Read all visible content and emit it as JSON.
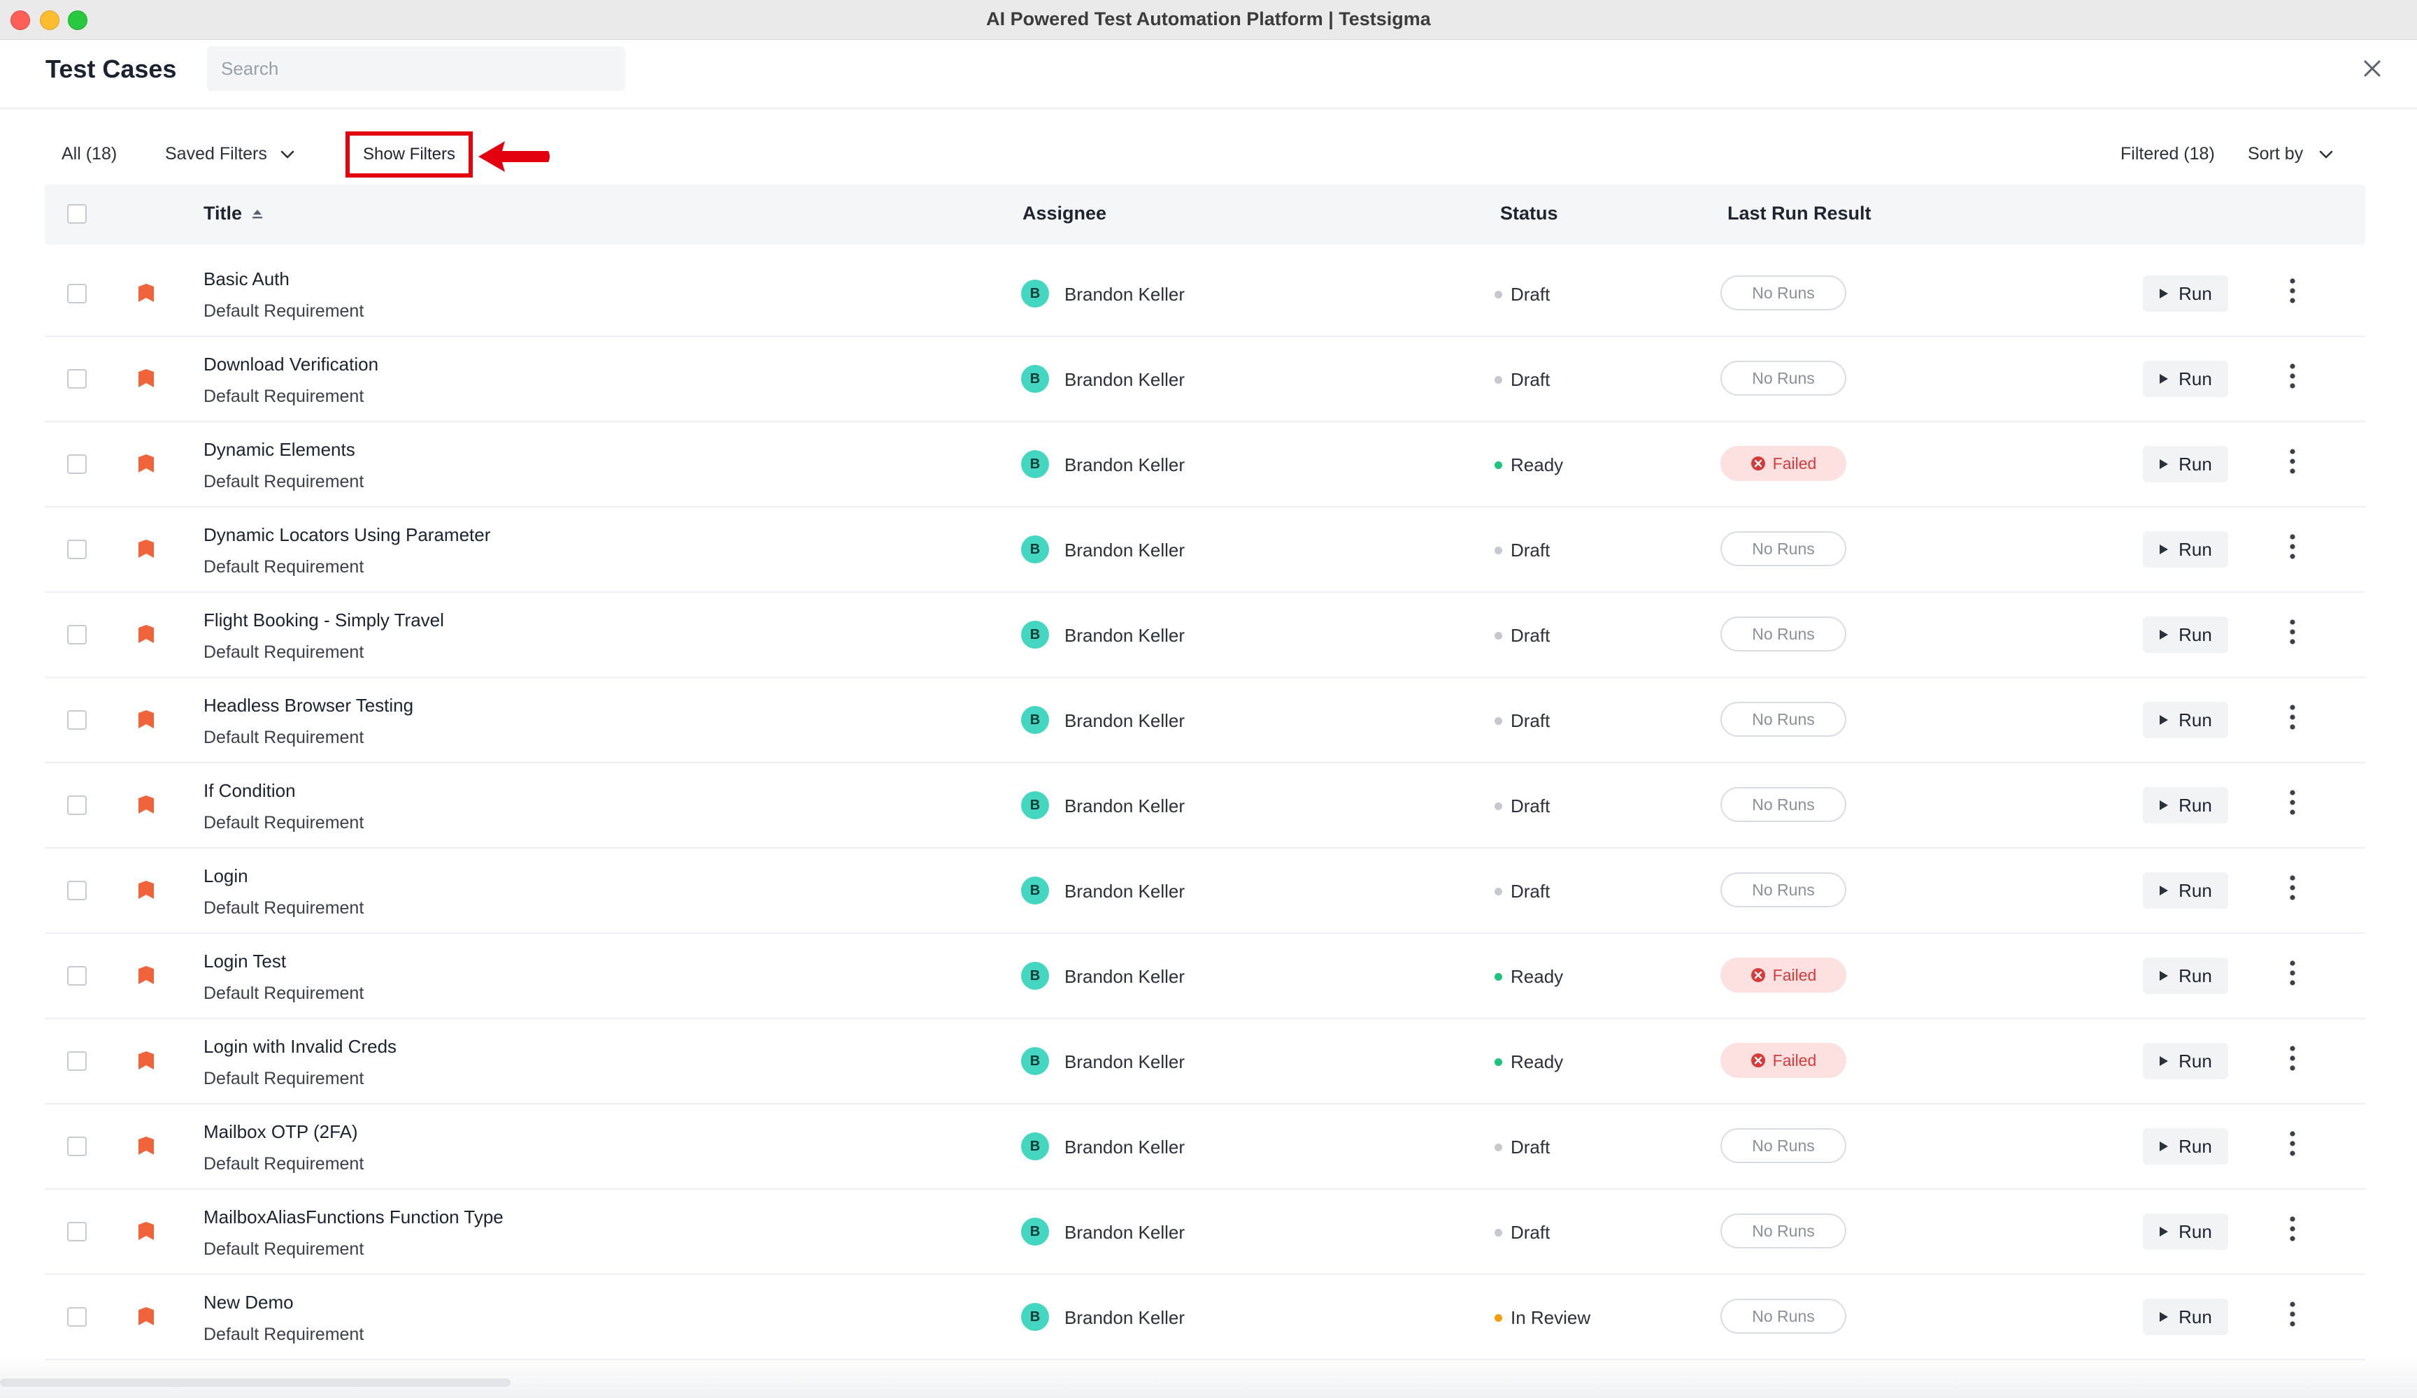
{
  "window": {
    "title": "AI Powered Test Automation Platform | Testsigma"
  },
  "header": {
    "title": "Test Cases",
    "search_placeholder": "Search",
    "close_icon": "close-icon"
  },
  "toolbar": {
    "all_label": "All (18)",
    "saved_filters_label": "Saved Filters",
    "show_filters_label": "Show Filters",
    "filtered_label": "Filtered (18)",
    "sort_by_label": "Sort by"
  },
  "table": {
    "columns": {
      "title": "Title",
      "assignee": "Assignee",
      "status": "Status",
      "last_run": "Last Run Result"
    },
    "run_label": "Run",
    "rows": [
      {
        "title": "Basic Auth",
        "requirement": "Default Requirement",
        "avatar": "B",
        "assignee": "Brandon Keller",
        "status": "Draft",
        "result": "No Runs"
      },
      {
        "title": "Download Verification",
        "requirement": "Default Requirement",
        "avatar": "B",
        "assignee": "Brandon Keller",
        "status": "Draft",
        "result": "No Runs"
      },
      {
        "title": "Dynamic Elements",
        "requirement": "Default Requirement",
        "avatar": "B",
        "assignee": "Brandon Keller",
        "status": "Ready",
        "result": "Failed"
      },
      {
        "title": "Dynamic Locators Using Parameter",
        "requirement": "Default Requirement",
        "avatar": "B",
        "assignee": "Brandon Keller",
        "status": "Draft",
        "result": "No Runs"
      },
      {
        "title": "Flight Booking - Simply Travel",
        "requirement": "Default Requirement",
        "avatar": "B",
        "assignee": "Brandon Keller",
        "status": "Draft",
        "result": "No Runs"
      },
      {
        "title": "Headless Browser Testing",
        "requirement": "Default Requirement",
        "avatar": "B",
        "assignee": "Brandon Keller",
        "status": "Draft",
        "result": "No Runs"
      },
      {
        "title": "If Condition",
        "requirement": "Default Requirement",
        "avatar": "B",
        "assignee": "Brandon Keller",
        "status": "Draft",
        "result": "No Runs"
      },
      {
        "title": "Login",
        "requirement": "Default Requirement",
        "avatar": "B",
        "assignee": "Brandon Keller",
        "status": "Draft",
        "result": "No Runs"
      },
      {
        "title": "Login Test",
        "requirement": "Default Requirement",
        "avatar": "B",
        "assignee": "Brandon Keller",
        "status": "Ready",
        "result": "Failed"
      },
      {
        "title": "Login with Invalid Creds",
        "requirement": "Default Requirement",
        "avatar": "B",
        "assignee": "Brandon Keller",
        "status": "Ready",
        "result": "Failed"
      },
      {
        "title": "Mailbox OTP (2FA)",
        "requirement": "Default Requirement",
        "avatar": "B",
        "assignee": "Brandon Keller",
        "status": "Draft",
        "result": "No Runs"
      },
      {
        "title": "MailboxAliasFunctions Function Type",
        "requirement": "Default Requirement",
        "avatar": "B",
        "assignee": "Brandon Keller",
        "status": "Draft",
        "result": "No Runs"
      },
      {
        "title": "New Demo",
        "requirement": "Default Requirement",
        "avatar": "B",
        "assignee": "Brandon Keller",
        "status": "In Review",
        "result": "No Runs"
      }
    ]
  },
  "colors": {
    "status_draft": "#c5c9cf",
    "status_ready": "#1ec47b",
    "status_in_review": "#f59e0b",
    "priority": "#f0643c",
    "avatar": "#45d6c1",
    "failed": "#d63a3a",
    "annotation": "#e3000f"
  }
}
